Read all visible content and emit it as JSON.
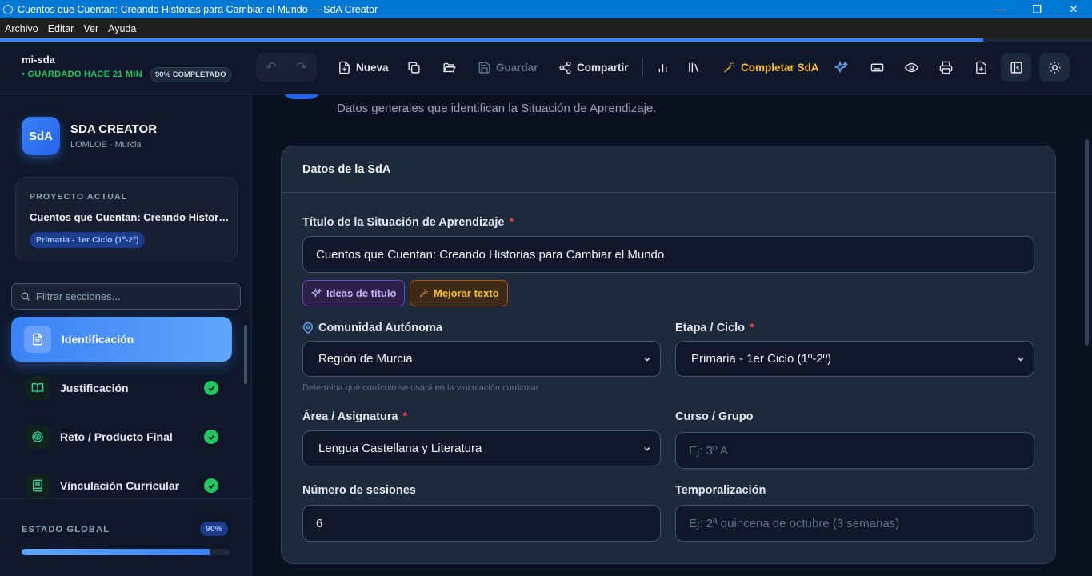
{
  "window": {
    "title": "Cuentos que Cuentan: Creando Historias para Cambiar el Mundo  — SdA Creator"
  },
  "menu": [
    "Archivo",
    "Editar",
    "Ver",
    "Ayuda"
  ],
  "progress": {
    "top_fraction": 0.9
  },
  "toolbar": {
    "project_name": "mi-sda",
    "saved_status": "• GUARDADO HACE 21 MIN",
    "completion_badge": "90% COMPLETADO",
    "new_label": "Nueva",
    "save_label": "Guardar",
    "share_label": "Compartir",
    "complete_label": "Completar SdA"
  },
  "sidebar": {
    "logo_text": "SdA",
    "brand": "SDA CREATOR",
    "brand_sub": "LOMLOE · Murcia",
    "project_label": "PROYECTO ACTUAL",
    "project_title": "Cuentos que Cuentan: Creando Historias para Cambiar el Mundo",
    "project_badge": "Primaria - 1er Ciclo (1º-2º)",
    "filter_placeholder": "Filtrar secciones...",
    "items": [
      {
        "label": "Identificación",
        "icon": "document-icon",
        "active": true,
        "done": false
      },
      {
        "label": "Justificación",
        "icon": "book-icon",
        "active": false,
        "done": true
      },
      {
        "label": "Reto / Producto Final",
        "icon": "target-icon",
        "active": false,
        "done": true
      },
      {
        "label": "Vinculación Curricular",
        "icon": "bookmark-book-icon",
        "active": false,
        "done": true
      }
    ],
    "global_label": "ESTADO GLOBAL",
    "global_pct": "90%",
    "global_fraction": 0.9
  },
  "main": {
    "subtitle": "Datos generales que identifican la Situación de Aprendizaje.",
    "card_title": "Datos de la SdA",
    "title_label": "Título de la Situación de Aprendizaje",
    "title_value": "Cuentos que Cuentan: Creando Historias para Cambiar el Mundo",
    "ideas_label": "Ideas de título",
    "improve_label": "Mejorar texto",
    "community_label": "Comunidad Autónoma",
    "community_value": "Región de Murcia",
    "community_hint": "Determina qué currículo se usará en la vinculación curricular",
    "stage_label": "Etapa / Ciclo",
    "stage_value": "Primaria - 1er Ciclo (1º-2º)",
    "area_label": "Área / Asignatura",
    "area_value": "Lengua Castellana y Literatura",
    "course_label": "Curso / Grupo",
    "course_placeholder": "Ej: 3º A",
    "sessions_label": "Número de sesiones",
    "sessions_value": "6",
    "timing_label": "Temporalización",
    "timing_placeholder": "Ej: 2ª quincena de octubre (3 semanas)",
    "required_mark": "*"
  },
  "colors": {
    "accent": "#3b82f6",
    "success": "#22c55e",
    "warning": "#fbbf24",
    "required": "#ef4444"
  }
}
